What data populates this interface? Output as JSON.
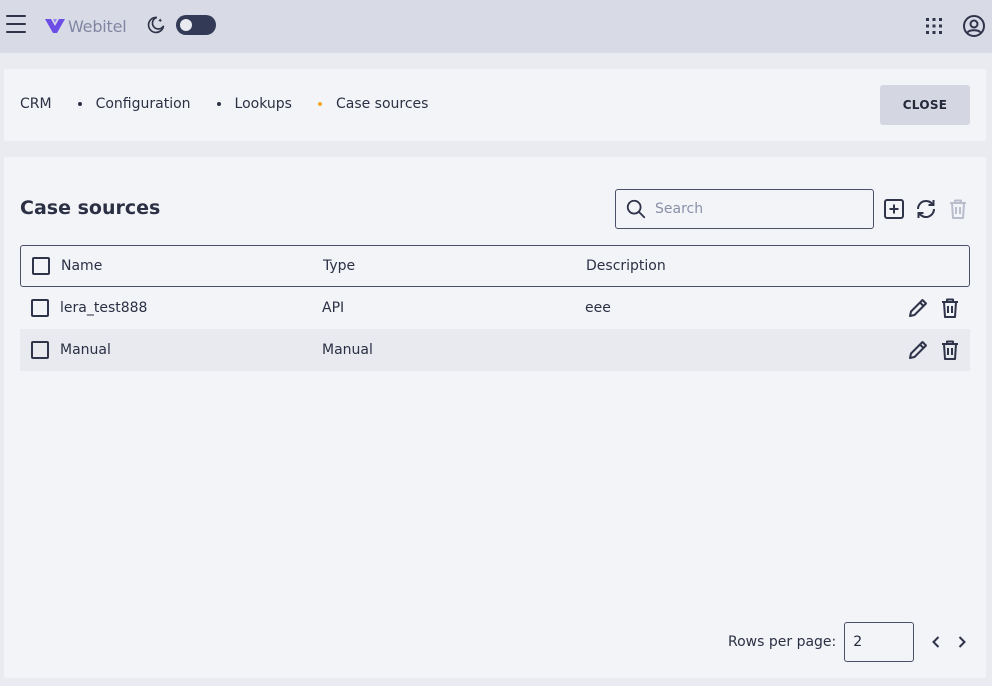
{
  "header": {
    "logo_text": "Webitel",
    "theme_toggle_on": false
  },
  "breadcrumbs": [
    {
      "label": "CRM"
    },
    {
      "label": "Configuration"
    },
    {
      "label": "Lookups"
    },
    {
      "label": "Case sources"
    }
  ],
  "close_label": "CLOSE",
  "page": {
    "title": "Case sources",
    "search_placeholder": "Search"
  },
  "table": {
    "columns": [
      "Name",
      "Type",
      "Description"
    ],
    "rows": [
      {
        "name": "lera_test888",
        "type": "API",
        "description": "eee"
      },
      {
        "name": "Manual",
        "type": "Manual",
        "description": ""
      }
    ]
  },
  "pagination": {
    "rows_per_page_label": "Rows per page:",
    "rows_per_page_value": "2"
  },
  "colors": {
    "accent": "#f5a623",
    "brand": "#6c4ee6",
    "text": "#2b3044"
  },
  "icons": [
    "menu-icon",
    "moon-icon",
    "apps-grid-icon",
    "account-circle-icon",
    "search-icon",
    "add-box-icon",
    "refresh-icon",
    "trash-icon",
    "pencil-icon",
    "chevron-left-icon",
    "chevron-right-icon"
  ]
}
